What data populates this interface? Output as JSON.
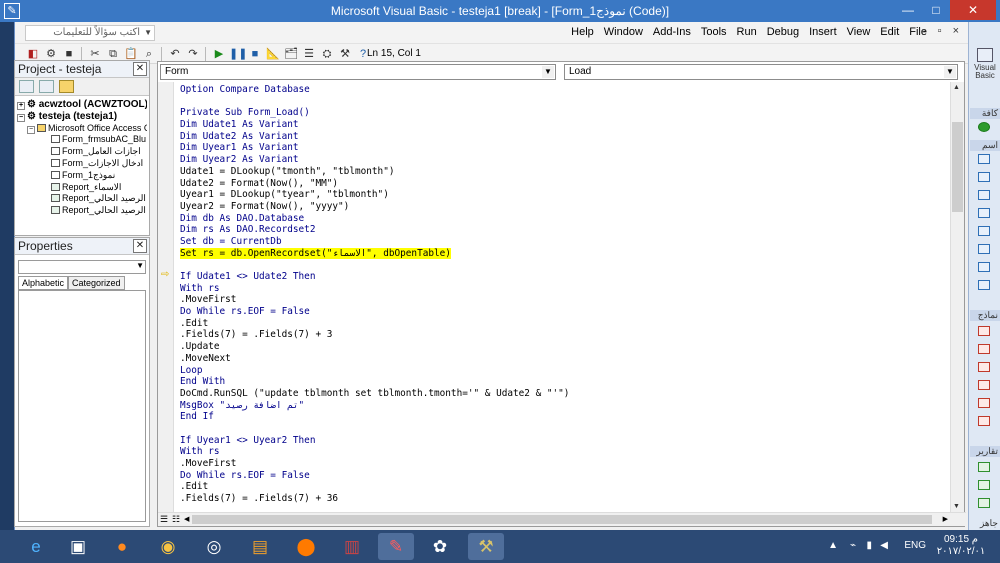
{
  "window": {
    "title": "Microsoft Visual Basic - testeja1 [break] - [Form_نموذج1 (Code)]",
    "min": "—",
    "max": "□",
    "close": "✕"
  },
  "menubar": {
    "ask_placeholder": "اكتب سؤالاً للتعليمات",
    "items": [
      "Help",
      "Window",
      "Add-Ins",
      "Tools",
      "Run",
      "Debug",
      "Insert",
      "View",
      "Edit",
      "File"
    ],
    "mdi_controls": "- ▫ ×"
  },
  "toolbar": {
    "position": "Ln 15, Col 1"
  },
  "project": {
    "title": "Project - testeja",
    "close": "✕",
    "tree": [
      {
        "text": "acwztool (ACWZTOOL)",
        "bold": true,
        "level": 0
      },
      {
        "text": "testeja (testeja1)",
        "bold": true,
        "level": 0
      },
      {
        "text": "Microsoft Office Access C",
        "bold": false,
        "level": 1
      },
      {
        "text": "Form_frmsubAC_Blu",
        "bold": false,
        "level": 2
      },
      {
        "text": "Form_اجازات العامل",
        "bold": false,
        "level": 2
      },
      {
        "text": "Form_ادخال الاجازات",
        "bold": false,
        "level": 2
      },
      {
        "text": "Form_نموذج1",
        "bold": false,
        "level": 2
      },
      {
        "text": "Report_الاسماء",
        "bold": false,
        "level": 2
      },
      {
        "text": "Report_الرصيد الحالي",
        "bold": false,
        "level": 2
      },
      {
        "text": "Report_الرصيد الحالي",
        "bold": false,
        "level": 2
      }
    ]
  },
  "properties": {
    "title": "Properties",
    "close": "✕",
    "tabs": [
      "Alphabetic",
      "Categorized"
    ]
  },
  "code_window": {
    "object_combo": "Form",
    "proc_combo": "Load",
    "lines": [
      "Option Compare Database",
      "",
      "Private Sub Form_Load()",
      "Dim Udate1 As Variant",
      "Dim Udate2 As Variant",
      "Dim Uyear1 As Variant",
      "Dim Uyear2 As Variant",
      "Udate1 = DLookup(\"tmonth\", \"tblmonth\")",
      "Udate2 = Format(Now(), \"MM\")",
      "Uyear1 = DLookup(\"tyear\", \"tblmonth\")",
      "Uyear2 = Format(Now(), \"yyyy\")",
      "Dim db As DAO.Database",
      "Dim rs As DAO.Recordset2",
      "Set db = CurrentDb",
      "Set rs = db.OpenRecordset(\"الاسماء\", dbOpenTable)",
      "",
      "If Udate1 <> Udate2 Then",
      "With rs",
      ".MoveFirst",
      "Do While rs.EOF = False",
      ".Edit",
      ".Fields(7) = .Fields(7) + 3",
      ".Update",
      ".MoveNext",
      "Loop",
      "End With",
      "DoCmd.RunSQL (\"update tblmonth set tblmonth.tmonth='\" & Udate2 & \"'\")",
      "MsgBox \"تم اضافة رصيد\"",
      "End If",
      "",
      "If Uyear1 <> Uyear2 Then",
      "With rs",
      ".MoveFirst",
      "Do While rs.EOF = False",
      ".Edit",
      ".Fields(7) = .Fields(7) + 36"
    ],
    "highlight_line": 14
  },
  "access_side": {
    "app_label": "Visual Basic",
    "labels": [
      "كافة",
      "اسم",
      "نماذج",
      "تقارير",
      "جاهز"
    ]
  },
  "taskbar": {
    "time": "09:15 م",
    "date": "٢٠١٧/٠٢/٠١",
    "lang": "ENG"
  }
}
